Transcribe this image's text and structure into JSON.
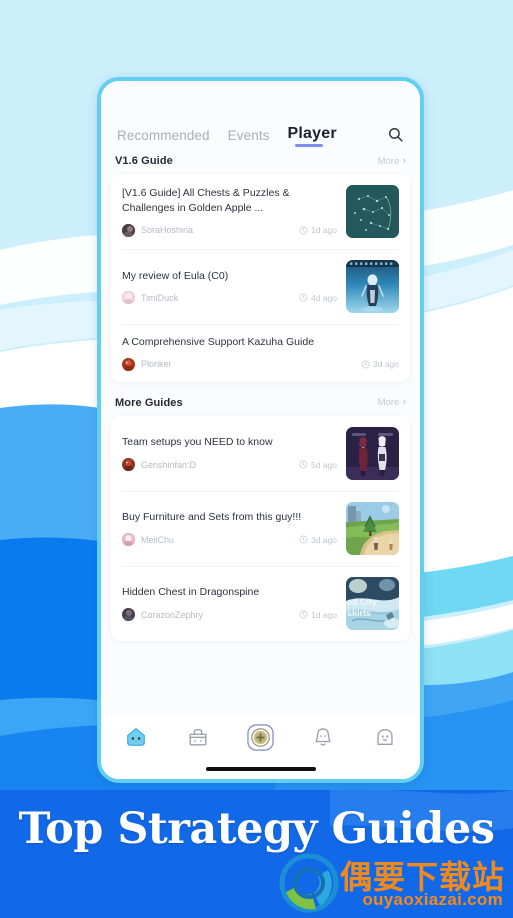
{
  "background": {
    "colors": {
      "sky": "#CCEFFB",
      "wave_white": "#FFFFFF",
      "wave_cyan": "#6FD8F2",
      "mid_blue": "#3AA6F5",
      "deep_blue": "#0A7BEE",
      "banner_blue": "#1269E8"
    }
  },
  "phone": {
    "frame_color": "#62CFF2",
    "screen_bg": "#FBFCFE"
  },
  "header": {
    "tabs": [
      {
        "label": "Recommended",
        "active": false
      },
      {
        "label": "Events",
        "active": false
      },
      {
        "label": "Player",
        "active": true
      }
    ],
    "active_underline_color": "#7E8DF0",
    "search_icon": "search-icon"
  },
  "sections": [
    {
      "title": "V1.6 Guide",
      "more_label": "More",
      "more_icon": "chevron-right-icon",
      "items": [
        {
          "title": "[V1.6 Guide] All Chests & Puzzles & Challenges in Golden Apple ...",
          "author": "SoraHoshina",
          "time": "1d ago",
          "time_icon": "clock-icon",
          "avatar_color": "#4A3B44",
          "thumb": "constellation-map",
          "thumb_caption": ""
        },
        {
          "title": "My review of Eula (C0)",
          "author": "TimiDuck",
          "time": "4d ago",
          "time_icon": "clock-icon",
          "avatar_color": "#E8CBD6",
          "thumb": "eula-character",
          "thumb_caption": ""
        },
        {
          "title": "A Comprehensive Support Kazuha Guide",
          "author": "Plonker",
          "time": "3d ago",
          "time_icon": "clock-icon",
          "avatar_color": "#B4442B",
          "thumb": "",
          "thumb_caption": ""
        }
      ]
    },
    {
      "title": "More Guides",
      "more_label": "More",
      "more_icon": "chevron-right-icon",
      "items": [
        {
          "title": "Team setups you NEED to know",
          "author": "Genshinfan:D",
          "time": "5d ago",
          "time_icon": "clock-icon",
          "avatar_color": "#9E3B2A",
          "thumb": "two-characters",
          "thumb_caption": ""
        },
        {
          "title": "Buy Furniture and Sets from this guy!!!",
          "author": "MeiiChu",
          "time": "3d ago",
          "time_icon": "clock-icon",
          "avatar_color": "#E5B9C9",
          "thumb": "serenitea-pot",
          "thumb_caption": ""
        },
        {
          "title": "Hidden Chest in Dragonspine",
          "author": "CorazonZephry",
          "time": "1d ago",
          "time_icon": "clock-icon",
          "avatar_color": "#4C4450",
          "thumb": "dragonspine-map",
          "thumb_caption_line1": "ed City",
          "thumb_caption_line2": "skirts"
        }
      ]
    }
  ],
  "bottom_nav": [
    {
      "icon": "slime-home-icon",
      "active": true
    },
    {
      "icon": "shop-bag-icon",
      "active": false
    },
    {
      "icon": "add-plus-badge-icon",
      "active": false
    },
    {
      "icon": "bell-notification-icon",
      "active": false
    },
    {
      "icon": "ghost-profile-icon",
      "active": false
    }
  ],
  "banner": {
    "headline": "Top Strategy Guides",
    "watermark_cn": "偶要下载站",
    "watermark_url": "ouyaoxiazai.com",
    "watermark_color": "#F08A1E"
  }
}
